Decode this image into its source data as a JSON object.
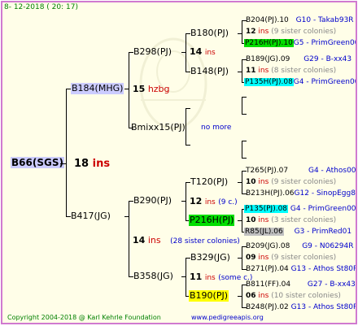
{
  "header": {
    "date": "8- 12-2018 ( 20: 17)"
  },
  "footer": {
    "copyright": "Copyright 2004-2018 @ Karl Kehrle Foundation",
    "url": "www.pedigreeapis.org"
  },
  "root": {
    "name": "B66(SGS)",
    "num": "18",
    "suffix": "ins"
  },
  "b184": {
    "name": "B184(MHG)",
    "num": "15",
    "suffix": "hzbg"
  },
  "b417": {
    "name": "B417(JG)",
    "num": "14",
    "suffix": "ins",
    "note": "(28 sister colonies)"
  },
  "b298": {
    "name": "B298(PJ)",
    "num": "14",
    "suffix": "ins"
  },
  "bmixx": {
    "name": "Bmixx15(PJ)",
    "note": "no more"
  },
  "b290": {
    "name": "B290(PJ)",
    "num": "12",
    "suffix": "ins",
    "note": "(9 c.)"
  },
  "b358": {
    "name": "B358(JG)",
    "num": "11",
    "suffix": "ins",
    "note": "(some c.)"
  },
  "b180": {
    "name": "B180(PJ)",
    "num": "12",
    "suffix": "ins",
    "note": "(9 sister colonies)"
  },
  "b148": {
    "name": "B148(PJ)",
    "num": "11",
    "suffix": "ins",
    "note": "(8 sister colonies)"
  },
  "t120": {
    "name": "T120(PJ)",
    "num": "10",
    "suffix": "ins",
    "note": "(9 sister colonies)"
  },
  "p216": {
    "name": "P216H(PJ)",
    "num": "10",
    "suffix": "ins",
    "note": "(3 sister colonies)"
  },
  "b329": {
    "name": "B329(JG)",
    "num": "09",
    "suffix": "ins",
    "note": "(9 sister colonies)"
  },
  "b190": {
    "name": "B190(PJ)",
    "num": "06",
    "suffix": "ins",
    "note": "(10 sister colonies)"
  },
  "g4": {
    "r1": {
      "name": "B204(PJ).10",
      "code": "G10 - Takab93R"
    },
    "r2": {
      "name": "P216H(PJ).10",
      "code": "G5 - PrimGreen00"
    },
    "r3": {
      "name": "B189(JG).09",
      "code": "G29 - B-xx43"
    },
    "r4": {
      "name": "P135H(PJ).08",
      "code": "G4 - PrimGreen00"
    },
    "r5": {
      "name": "T265(PJ).07",
      "code": "G4 - Athos00R"
    },
    "r6": {
      "name": "B213H(PJ).06",
      "code": "G12 - SinopEgg86R"
    },
    "r7": {
      "name": "P135(PJ).08",
      "code": "G4 - PrimGreen00"
    },
    "r8": {
      "name": "R85(JL).06",
      "code": "G3 - PrimRed01"
    },
    "r9": {
      "name": "B209(JG).08",
      "code": "G9 - N06294R"
    },
    "r10": {
      "name": "B271(PJ).04",
      "code": "G13 - Athos St80R"
    },
    "r11": {
      "name": "B811(FF).04",
      "code": "G27 - B-xx43"
    },
    "r12": {
      "name": "B248(PJ).02",
      "code": "G13 - Athos St80R"
    }
  },
  "colors": {
    "border": "#d07ad0",
    "background": "#fffee8",
    "green_box": "#00dd00",
    "cyan_box": "#00ffff",
    "gray_box": "#c0c0c0",
    "yellow_box": "#ffff00",
    "root_box": "#ccccff"
  }
}
